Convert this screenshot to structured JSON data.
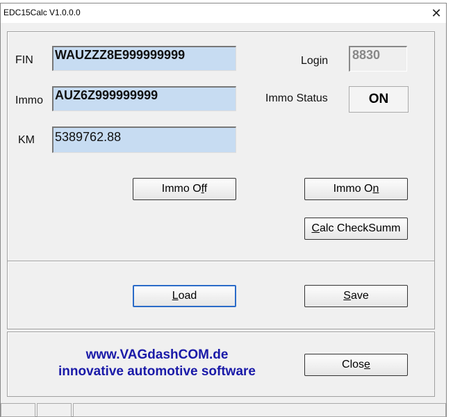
{
  "window": {
    "title": "EDC15Calc V1.0.0.0",
    "close_icon": "close-icon"
  },
  "fields": {
    "fin": {
      "label": "FIN",
      "value": "WAUZZZ8E999999999"
    },
    "immo": {
      "label": "Immo",
      "value": "AUZ6Z999999999"
    },
    "km": {
      "label": "KM",
      "value": "5389762.88"
    },
    "login": {
      "label": "Login",
      "value": "8830"
    },
    "immo_status": {
      "label": "Immo Status",
      "value": "ON"
    }
  },
  "buttons": {
    "immo_off": {
      "pre": "Immo O",
      "key": "f",
      "post": "f"
    },
    "immo_on": {
      "pre": "Immo O",
      "key": "n",
      "post": ""
    },
    "calc": {
      "pre": "",
      "key": "C",
      "post": "alc CheckSumm"
    },
    "load": {
      "pre": "",
      "key": "L",
      "post": "oad"
    },
    "save": {
      "pre": "",
      "key": "S",
      "post": "ave"
    },
    "close": {
      "pre": "Clos",
      "key": "e",
      "post": ""
    }
  },
  "footer": {
    "website": "www.VAGdashCOM.de",
    "tagline": "innovative automotive software"
  }
}
